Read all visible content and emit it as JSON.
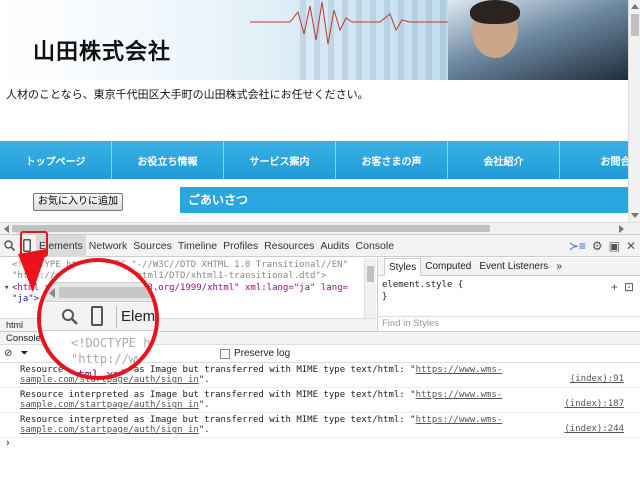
{
  "site": {
    "title": "山田株式会社",
    "tagline": "人材のことなら、東京千代田区大手町の山田株式会社にお任せください。",
    "nav": [
      "トップページ",
      "お役立ち情報",
      "サービス案内",
      "お客さまの声",
      "会社紹介",
      "お問合"
    ],
    "favorite_button": "お気に入りに追加",
    "greeting": "ごあいさつ"
  },
  "devtools": {
    "tabs": [
      "Elements",
      "Network",
      "Sources",
      "Timeline",
      "Profiles",
      "Resources",
      "Audits",
      "Console"
    ],
    "active_tab": "Elements",
    "elements": {
      "line1": "<!DOCTYPE html PUBLIC \"-//W3C//DTD XHTML 1.0 Transitional//EN\"",
      "line2": "\"http://www.w3.org/TR/xhtml1/DTD/xhtml1-transitional.dtd\">",
      "line3": "<html xmlns=\"http://www.w3.org/1999/xhtml\" xml:lang=\"ja\" lang=",
      "line4": "\"ja\">"
    },
    "breadcrumb": "html",
    "styles_tabs": [
      "Styles",
      "Computed",
      "Event Listeners",
      "»"
    ],
    "styles_rule": "element.style {",
    "styles_close": "}",
    "styles_filter": "Find in Styles",
    "console_label": "Console",
    "preserve_log": "Preserve log",
    "messages": [
      {
        "text": "Resource interpreted as Image but transferred with MIME type text/html: \"",
        "link": "https://www.wms-sample.com/startpage/auth/sign_in",
        "end": "\".",
        "source": "(index):91"
      },
      {
        "text": "Resource interpreted as Image but transferred with MIME type text/html: \"",
        "link": "https://www.wms-sample.com/startpage/auth/sign_in",
        "end": "\".",
        "source": "(index):187"
      },
      {
        "text": "Resource interpreted as Image but transferred with MIME type text/html: \"",
        "link": "https://www.wms-sample.com/startpage/auth/sign_in",
        "end": "\".",
        "source": "(index):244"
      }
    ],
    "prompt": "›"
  },
  "magnifier": {
    "elements_label": "Elemen",
    "line1": "<!DOCTYPE ht",
    "line1b": "ring",
    "line2": "\"http://www",
    "line3": "<html xmln"
  },
  "colors": {
    "accent": "#29a7df",
    "highlight": "#e8131b"
  }
}
